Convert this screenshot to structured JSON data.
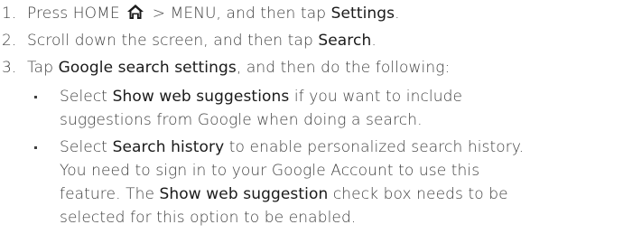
{
  "steps": [
    {
      "number": "1.",
      "parts": {
        "a": "Press HOME ",
        "b": " > MENU, and then tap ",
        "c": "Settings",
        "d": "."
      },
      "icon": "home-icon"
    },
    {
      "number": "2.",
      "parts": {
        "a": "Scroll down the screen, and then tap ",
        "b": "Search",
        "c": "."
      }
    },
    {
      "number": "3.",
      "parts": {
        "a": "Tap ",
        "b": "Google search settings",
        "c": ", and then do the following:"
      }
    }
  ],
  "bullets": [
    {
      "line1": {
        "a": "Select ",
        "b": "Show web suggestions",
        "c": " if you want to include"
      },
      "line2": "suggestions from Google when doing a search."
    },
    {
      "line1": {
        "a": "Select ",
        "b": "Search history",
        "c": " to enable personalized search history."
      },
      "line2": "You need to sign in to your Google Account to use this",
      "line3": {
        "a": "feature. The ",
        "b": "Show web suggestion",
        "c": " check box needs to be"
      },
      "line4": "selected for this option to be enabled."
    }
  ]
}
